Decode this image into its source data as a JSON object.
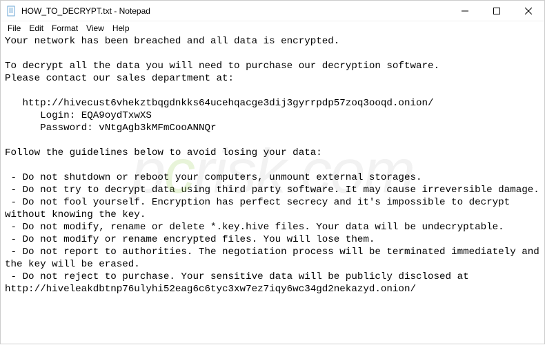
{
  "window": {
    "title": "HOW_TO_DECRYPT.txt - Notepad"
  },
  "menu": {
    "file": "File",
    "edit": "Edit",
    "format": "Format",
    "view": "View",
    "help": "Help"
  },
  "document": {
    "text": "Your network has been breached and all data is encrypted.\n\nTo decrypt all the data you will need to purchase our decryption software.\nPlease contact our sales department at:\n\n   http://hivecust6vhekztbqgdnkks64ucehqacge3dij3gyrrpdp57zoq3ooqd.onion/\n      Login: EQA9oydTxwXS\n      Password: vNtgAgb3kMFmCooANNQr\n\nFollow the guidelines below to avoid losing your data:\n\n - Do not shutdown or reboot your computers, unmount external storages.\n - Do not try to decrypt data using third party software. It may cause irreversible damage.\n - Do not fool yourself. Encryption has perfect secrecy and it's impossible to decrypt without knowing the key.\n - Do not modify, rename or delete *.key.hive files. Your data will be undecryptable.\n - Do not modify or rename encrypted files. You will lose them.\n - Do not report to authorities. The negotiation process will be terminated immediately and the key will be erased.\n - Do not reject to purchase. Your sensitive data will be publicly disclosed at http://hiveleakdbtnp76ulyhi52eag6c6tyc3xw7ez7iqy6wc34gd2nekazyd.onion/"
  }
}
